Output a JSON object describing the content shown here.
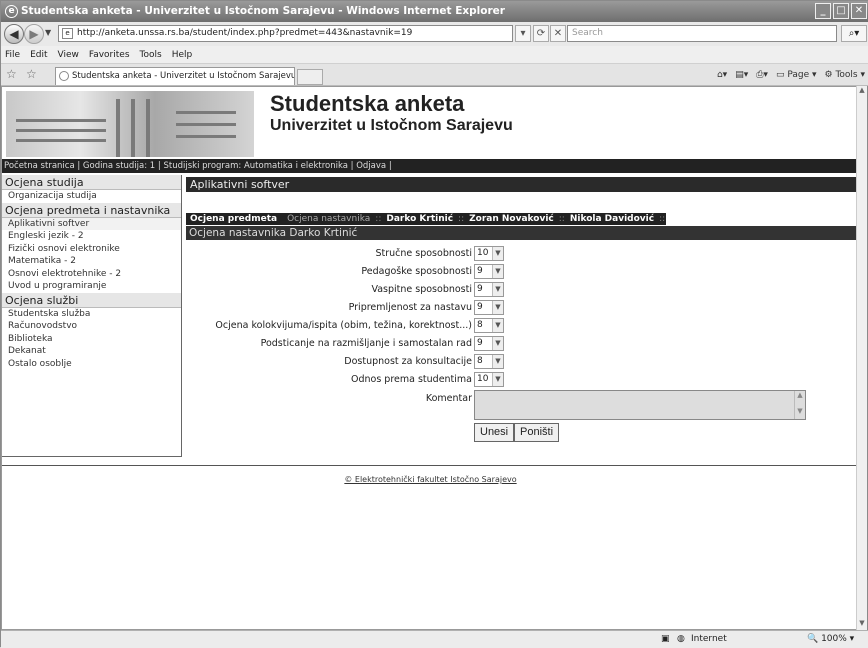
{
  "window": {
    "title": "Studentska anketa - Univerzitet u Istočnom Sarajevu - Windows Internet Explorer"
  },
  "address": {
    "url": "http://anketa.unssa.rs.ba/student/index.php?predmet=443&nastavnik=19",
    "search_placeholder": "Search"
  },
  "menu": [
    "File",
    "Edit",
    "View",
    "Favorites",
    "Tools",
    "Help"
  ],
  "tab": {
    "label": "Studentska anketa - Univerzitet u Istočnom Sarajevu"
  },
  "commandbar": {
    "page": "Page",
    "tools": "Tools"
  },
  "header": {
    "title": "Studentska anketa",
    "subtitle": "Univerzitet u Istočnom Sarajevu"
  },
  "navline": "Početna stranica | Godina studija: 1 | Studijski program: Automatika i elektronika | Odjava |",
  "sidebar": {
    "sections": [
      {
        "label": "Ocjena studija",
        "items": [
          "Organizacija studija"
        ]
      },
      {
        "label": "Ocjena predmeta i nastavnika",
        "items": [
          "Aplikativni softver",
          "Engleski jezik - 2",
          "Fizički osnovi elektronike",
          "Matematika - 2",
          "Osnovi elektrotehnike - 2",
          "Uvod u programiranje"
        ]
      },
      {
        "label": "Ocjena službi",
        "items": [
          "Studentska služba",
          "Računovodstvo",
          "Biblioteka",
          "Dekanat",
          "Ostalo osoblje"
        ]
      }
    ]
  },
  "main": {
    "subject": "Aplikativni softver",
    "tabs": {
      "active": "Ocjena predmeta",
      "inactive": "Ocjena nastavnika",
      "teachers": [
        "Darko Krtinić",
        "Zoran Novaković",
        "Nikola Davidović"
      ]
    },
    "section_title": "Ocjena nastavnika Darko Krtinić",
    "questions": [
      {
        "label": "Stručne sposobnosti",
        "value": "10"
      },
      {
        "label": "Pedagoške sposobnosti",
        "value": "9"
      },
      {
        "label": "Vaspitne sposobnosti",
        "value": "9"
      },
      {
        "label": "Pripremljenost za nastavu",
        "value": "9"
      },
      {
        "label": "Ocjena kolokvijuma/ispita (obim, težina, korektnost...)",
        "value": "8"
      },
      {
        "label": "Podsticanje na razmišljanje i samostalan rad",
        "value": "9"
      },
      {
        "label": "Dostupnost za konsultacije",
        "value": "8"
      },
      {
        "label": "Odnos prema studentima",
        "value": "10"
      }
    ],
    "comment_label": "Komentar",
    "submit": "Unesi",
    "reset": "Poništi"
  },
  "footer": "© Elektrotehnički fakultet Istočno Sarajevo",
  "status": {
    "zone": "Internet",
    "zoom": "100%"
  }
}
